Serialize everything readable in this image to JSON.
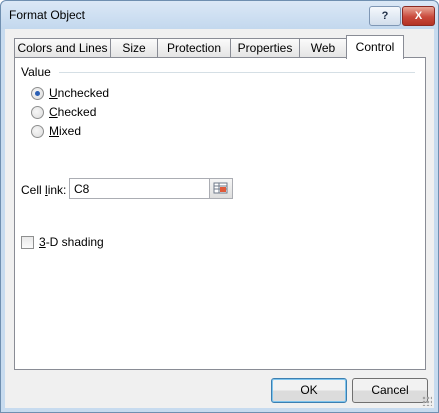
{
  "window": {
    "title": "Format Object",
    "help_label": "?",
    "close_label": "X"
  },
  "tabs": [
    {
      "label": "Colors and Lines",
      "active": false
    },
    {
      "label": "Size",
      "active": false
    },
    {
      "label": "Protection",
      "active": false
    },
    {
      "label": "Properties",
      "active": false
    },
    {
      "label": "Web",
      "active": false
    },
    {
      "label": "Control",
      "active": true
    }
  ],
  "control": {
    "value_group_label": "Value",
    "radios": [
      {
        "mnemonic": "U",
        "rest": "nchecked",
        "selected": true
      },
      {
        "mnemonic": "C",
        "rest": "hecked",
        "selected": false
      },
      {
        "mnemonic": "M",
        "rest": "ixed",
        "selected": false
      }
    ],
    "cell_link": {
      "label_before": "Cell ",
      "mnemonic": "l",
      "label_after": "ink:",
      "value": "C8"
    },
    "shading": {
      "mnemonic": "3",
      "rest": "-D shading",
      "checked": false
    }
  },
  "buttons": {
    "ok": "OK",
    "cancel": "Cancel"
  },
  "colors": {
    "selected_radio": "#2a5fb5",
    "close_button": "#c94a3c"
  }
}
